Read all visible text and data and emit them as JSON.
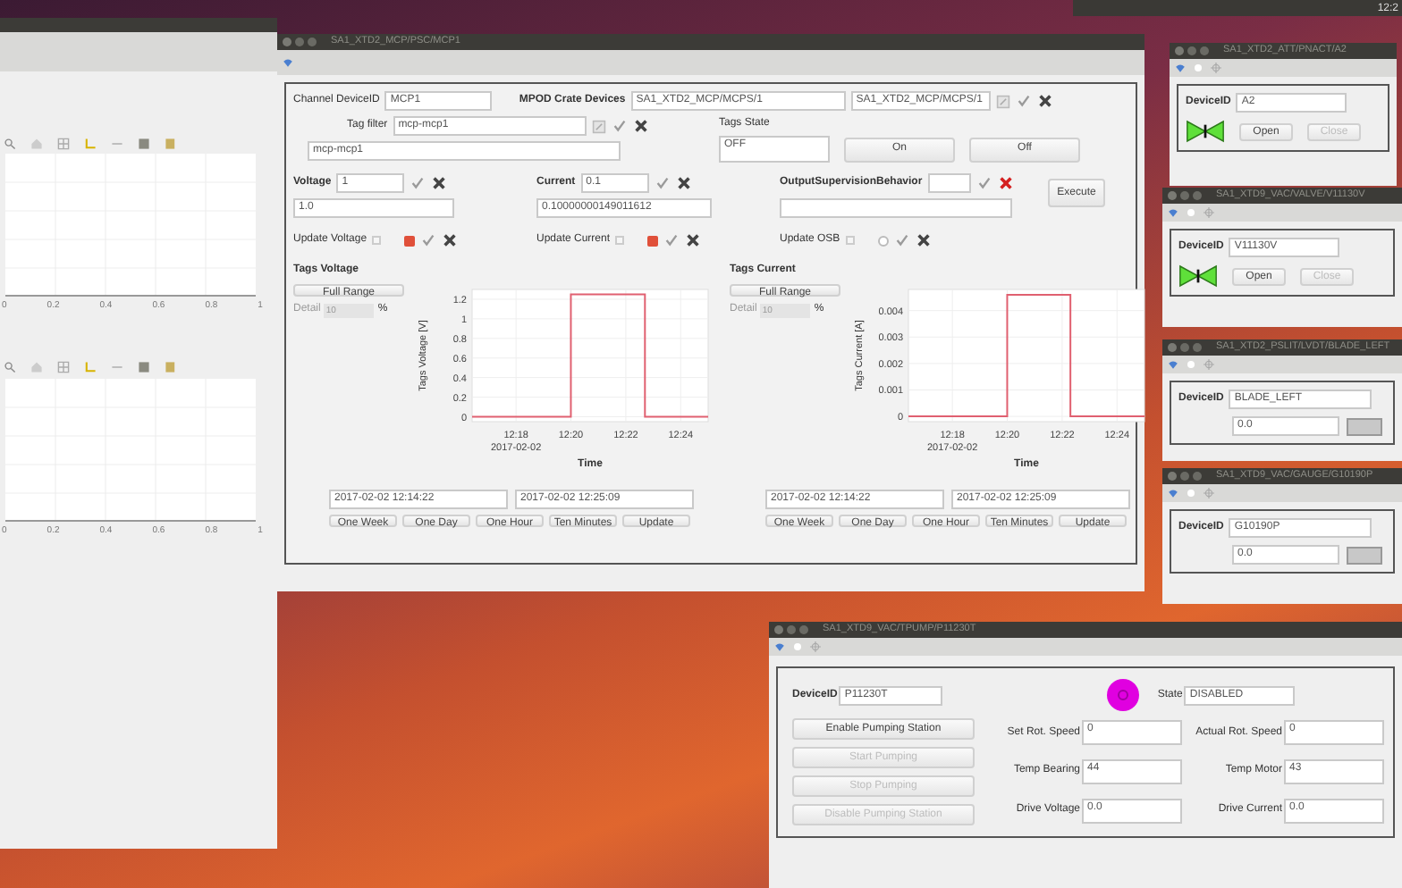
{
  "top_bar": {
    "clock": "12:2"
  },
  "left_window": {
    "plots": [
      {
        "x_tick_labels": [
          "0",
          "0.2",
          "0.4",
          "0.6",
          "0.8",
          "1"
        ]
      },
      {
        "x_tick_labels": [
          "0",
          "0.2",
          "0.4",
          "0.6",
          "0.8",
          "1"
        ]
      }
    ]
  },
  "main_window": {
    "title": "SA1_XTD2_MCP/PSC/MCP1",
    "channel_device": {
      "label": "Channel DeviceID",
      "value": "MCP1"
    },
    "crate": {
      "label": "MPOD Crate Devices",
      "value": "SA1_XTD2_MCP/MCPS/1",
      "reading": "SA1_XTD2_MCP/MCPS/1"
    },
    "tag_filter": {
      "label": "Tag filter",
      "value": "mcp-mcp1",
      "reading": "mcp-mcp1"
    },
    "tags_state": {
      "label": "Tags State",
      "value": "OFF",
      "buttons": [
        "On",
        "Off"
      ]
    },
    "setpoints": [
      {
        "label": "Voltage",
        "value": "1",
        "reading": "1.0",
        "dirty": false
      },
      {
        "label": "Current",
        "value": "0.1",
        "reading": "0.10000000149011612",
        "dirty": false
      },
      {
        "label": "OutputSupervisionBehavior",
        "dirty": true
      }
    ],
    "execute": "Execute",
    "updates": [
      {
        "label": "Update Voltage",
        "readback_disabled": true,
        "checked": true
      },
      {
        "label": "Update Current",
        "readback_disabled": true,
        "checked": true
      },
      {
        "label": "Update OSB",
        "readback_disabled": true,
        "checked": false
      }
    ],
    "charts": [
      {
        "title": "Tags Voltage",
        "full_range": "Full Range",
        "detail_label": "Detail",
        "detail_value": "10",
        "percent": "%",
        "start": "2017-02-02 12:14:22",
        "end": "2017-02-02 12:25:09",
        "range_buttons": [
          "One Week",
          "One Day",
          "One Hour",
          "Ten Minutes",
          "Update"
        ],
        "chart_data": {
          "type": "line",
          "grid": true,
          "xlabel": "Time",
          "ylabel": "Tags Voltage [V]",
          "x": [
            12.2733,
            12.3333,
            12.3333,
            12.3783,
            12.3783,
            12.4167
          ],
          "series": [
            {
              "color": "#e06070",
              "values": [
                0,
                0,
                1.25,
                1.25,
                0,
                0
              ]
            }
          ],
          "xlim": [
            12.2733,
            12.4167
          ],
          "ylim": [
            -0.05,
            1.3
          ],
          "xticks": [
            {
              "value": 12.3,
              "label": "12:18"
            },
            {
              "value": 12.3333,
              "label": "12:20"
            },
            {
              "value": 12.3667,
              "label": "12:22"
            },
            {
              "value": 12.4,
              "label": "12:24"
            }
          ],
          "yticks": [
            0,
            0.2,
            0.4,
            0.6,
            0.8,
            1,
            1.2
          ],
          "annotations": [
            "2017-02-02"
          ]
        }
      },
      {
        "title": "Tags Current",
        "full_range": "Full Range",
        "detail_label": "Detail",
        "detail_value": "10",
        "percent": "%",
        "start": "2017-02-02 12:14:22",
        "end": "2017-02-02 12:25:09",
        "range_buttons": [
          "One Week",
          "One Day",
          "One Hour",
          "Ten Minutes",
          "Update"
        ],
        "chart_data": {
          "type": "line",
          "grid": true,
          "xlabel": "Time",
          "ylabel": "Tags Current [A]",
          "x": [
            12.2733,
            12.3333,
            12.3333,
            12.3717,
            12.3717,
            12.4167
          ],
          "series": [
            {
              "color": "#e06070",
              "values": [
                0,
                0,
                0.0046,
                0.0046,
                0,
                0
              ]
            }
          ],
          "xlim": [
            12.2733,
            12.4167
          ],
          "ylim": [
            -0.0002,
            0.0048
          ],
          "xticks": [
            {
              "value": 12.3,
              "label": "12:18"
            },
            {
              "value": 12.3333,
              "label": "12:20"
            },
            {
              "value": 12.3667,
              "label": "12:22"
            },
            {
              "value": 12.4,
              "label": "12:24"
            }
          ],
          "yticks": [
            0,
            0.001,
            0.002,
            0.003,
            0.004
          ],
          "annotations": [
            "2017-02-02"
          ]
        }
      }
    ]
  },
  "right_windows": [
    {
      "kind": "valve",
      "title": "SA1_XTD2_ATT/PNACT/A2",
      "label": "DeviceID",
      "value": "A2",
      "buttons": [
        {
          "label": "Open",
          "disabled": false
        },
        {
          "label": "Close",
          "disabled": true
        }
      ]
    },
    {
      "kind": "valve",
      "title": "SA1_XTD9_VAC/VALVE/V11130V",
      "label": "DeviceID",
      "value": "V11130V",
      "buttons": [
        {
          "label": "Open",
          "disabled": false
        },
        {
          "label": "Close",
          "disabled": true
        }
      ]
    },
    {
      "kind": "reading",
      "title": "SA1_XTD2_PSLIT/LVDT/BLADE_LEFT",
      "label": "DeviceID",
      "value": "BLADE_LEFT",
      "reading": "0.0"
    },
    {
      "kind": "reading",
      "title": "SA1_XTD9_VAC/GAUGE/G10190P",
      "label": "DeviceID",
      "value": "G10190P",
      "reading": "0.0"
    }
  ],
  "pump_window": {
    "title": "SA1_XTD9_VAC/TPUMP/P11230T",
    "device_label": "DeviceID",
    "device_value": "P11230T",
    "state_label": "State",
    "state_value": "DISABLED",
    "buttons": [
      {
        "label": "Enable Pumping Station",
        "disabled": false
      },
      {
        "label": "Start Pumping",
        "disabled": true
      },
      {
        "label": "Stop Pumping",
        "disabled": true
      },
      {
        "label": "Disable Pumping Station",
        "disabled": true
      }
    ],
    "fields": [
      {
        "label": "Set Rot. Speed",
        "value": "0"
      },
      {
        "label": "Actual Rot. Speed",
        "value": "0"
      },
      {
        "label": "Temp Bearing",
        "value": "44"
      },
      {
        "label": "Temp Motor",
        "value": "43"
      },
      {
        "label": "Drive Voltage",
        "value": "0.0"
      },
      {
        "label": "Drive Current",
        "value": "0.0"
      }
    ]
  }
}
